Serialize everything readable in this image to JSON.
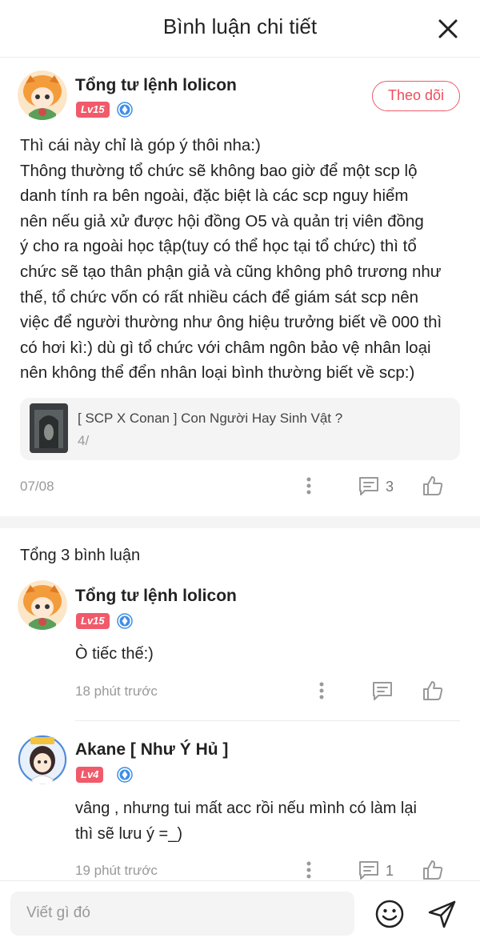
{
  "header": {
    "title": "Bình luận chi tiết",
    "close_icon": "close-icon"
  },
  "main_comment": {
    "username": "Tổng tư lệnh lolicon",
    "level": "Lv15",
    "follow_label": "Theo dõi",
    "text": "Thì cái này chỉ là góp ý thôi nha:)\nThông thường tổ chức sẽ không bao giờ để một scp lộ\ndanh tính ra bên ngoài, đặc biệt là các scp nguy hiểm\nnên nếu giả xử được hội đồng O5 và quản trị viên đồng\ný cho ra ngoài học tập(tuy có thể học tại tổ chức) thì tổ\nchức sẽ tạo thân phận giả và cũng không phô trương như\nthế, tổ chức vốn có rất nhiều cách để giám sát scp nên\nviệc để người thường như ông hiệu trưởng biết về 000 thì\ncó hơi kì:) dù gì tổ chức với châm ngôn bảo vệ nhân loại\nnên không thể đển nhân loại bình thường biết về scp:)",
    "story": {
      "title": "[ SCP X Conan ] Con Người Hay Sinh Vật ?",
      "chapter": "4/"
    },
    "date": "07/08",
    "reply_count": "3"
  },
  "total_label": "Tổng 3 bình luận",
  "replies": [
    {
      "username": "Tổng tư lệnh lolicon",
      "level": "Lv15",
      "text": "Ò tiếc thế:)",
      "time": "18 phút trước"
    },
    {
      "username": "Akane [ Như Ý Hủ ]",
      "level": "Lv4",
      "text": "vâng , nhưng tui mất acc rồi nếu mình có làm lại\nthì sẽ lưu ý =_)",
      "time": "19 phút trước",
      "reply_count": "1"
    }
  ],
  "footer": {
    "placeholder": "Viết gì đó",
    "emoji_icon": "smiley-icon",
    "send_icon": "send-icon"
  },
  "colors": {
    "accent": "#ef4c5c",
    "level_badge": "#f05a6a",
    "verify": "#3d8ee8"
  }
}
